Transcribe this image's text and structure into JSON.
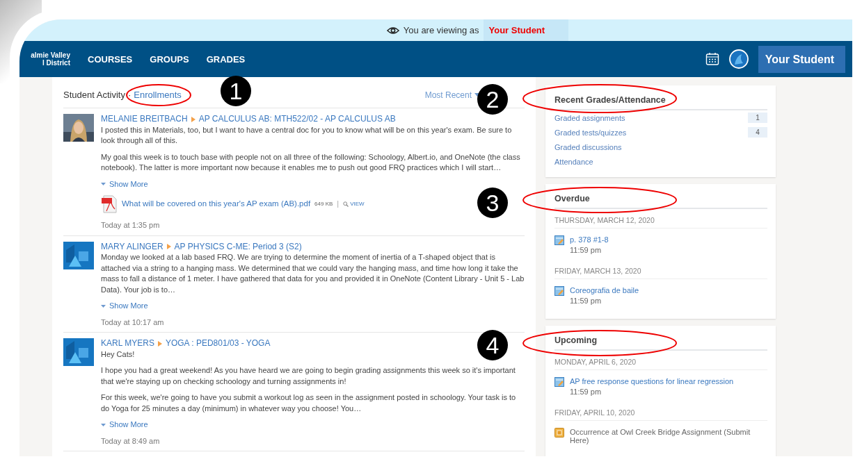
{
  "banner": {
    "text": "You are viewing as",
    "name": "Your Student"
  },
  "nav": {
    "logo_lines": [
      "almie Valley",
      "l District"
    ],
    "links": [
      "COURSES",
      "GROUPS",
      "GRADES"
    ],
    "user": "Your Student"
  },
  "activity": {
    "title": "Student Activity",
    "separator": "·",
    "link": "Enrollments",
    "sort": "Most Recent",
    "posts": [
      {
        "avatar": {
          "kind": "picture"
        },
        "author": "MELANIE BREITBACH",
        "course": "AP CALCULUS AB: MTH522/02 - AP CALCULUS AB",
        "paragraphs": [
          "I posted this in Materials, too, but I want to have a central doc for you to know what will be on this year's exam. Be sure to look through all of this.",
          "My goal this week is to touch base with people not on all three of the following: Schoology, Albert.io, and OneNote (the class notebook). The latter is more important now because it enables me to push out good FRQ practices which I will start…"
        ],
        "show_more": "Show More",
        "attachment": {
          "name": "What will be covered on this year's AP exam (AB).pdf",
          "size": "649 KB",
          "separator": "|",
          "action": "VIEW"
        },
        "time": "Today at 1:35 pm"
      },
      {
        "avatar": {
          "kind": "default"
        },
        "author": "MARY ALINGER",
        "course": "AP PHYSICS C-ME: Period 3 (S2)",
        "paragraphs": [
          "Monday we looked at a lab based FRQ.  We are trying to determine the moment of inertia of a T-shaped object that is attached via a string to a hanging mass.  We determined that we could vary the hanging mass, and time how long it take the mass to fall a distance of 1 meter.  I have gathered that data for you and provided it in OneNote (Content Library - Unit 5 - Lab Data).  Your job is to…"
        ],
        "show_more": "Show More",
        "time": "Today at 10:17 am"
      },
      {
        "avatar": {
          "kind": "default"
        },
        "author": "KARL MYERS",
        "course": "YOGA : PED801/03 - YOGA",
        "paragraphs": [
          "Hey Cats!",
          "I hope you had a great weekend! As you have heard we are going to begin grading assignments this week so it's important that we're staying up on checking schoology and turning assignments in!",
          "For this week, we're going to have you submit a workout log as seen in the assignment posted in schoology. Your task is to do Yoga for 25 minutes a day (minimum) in whatever way you choose! You…"
        ],
        "show_more": "Show More",
        "time": "Today at 8:49 am"
      }
    ]
  },
  "sidebar": [
    {
      "kind": "grades",
      "title": "Recent Grades/Attendance",
      "items": [
        {
          "label": "Graded assignments",
          "count": "1"
        },
        {
          "label": "Graded tests/quizzes",
          "count": "4"
        },
        {
          "label": "Graded discussions"
        },
        {
          "label": "Attendance"
        }
      ]
    },
    {
      "kind": "events",
      "title": "Overdue",
      "groups": [
        {
          "date": "THURSDAY, MARCH 12, 2020",
          "items": [
            {
              "kind": "assignment",
              "title": "p. 378 #1-8",
              "time": "11:59 pm"
            }
          ]
        },
        {
          "date": "FRIDAY, MARCH 13, 2020",
          "items": [
            {
              "kind": "assignment",
              "title": "Coreografia de baile",
              "time": "11:59 pm"
            }
          ]
        }
      ]
    },
    {
      "kind": "events",
      "title": "Upcoming",
      "groups": [
        {
          "date": "MONDAY, APRIL 6, 2020",
          "items": [
            {
              "kind": "assignment",
              "title": "AP free response questions for linear regression",
              "time": "11:59 pm"
            }
          ]
        },
        {
          "date": "FRIDAY, APRIL 10, 2020",
          "items": [
            {
              "kind": "dropbox",
              "title": "Occurrence at Owl Creek Bridge Assignment (Submit Here)"
            }
          ]
        }
      ]
    }
  ],
  "annotations": [
    {
      "number": "1"
    },
    {
      "number": "2"
    },
    {
      "number": "3"
    },
    {
      "number": "4"
    }
  ]
}
